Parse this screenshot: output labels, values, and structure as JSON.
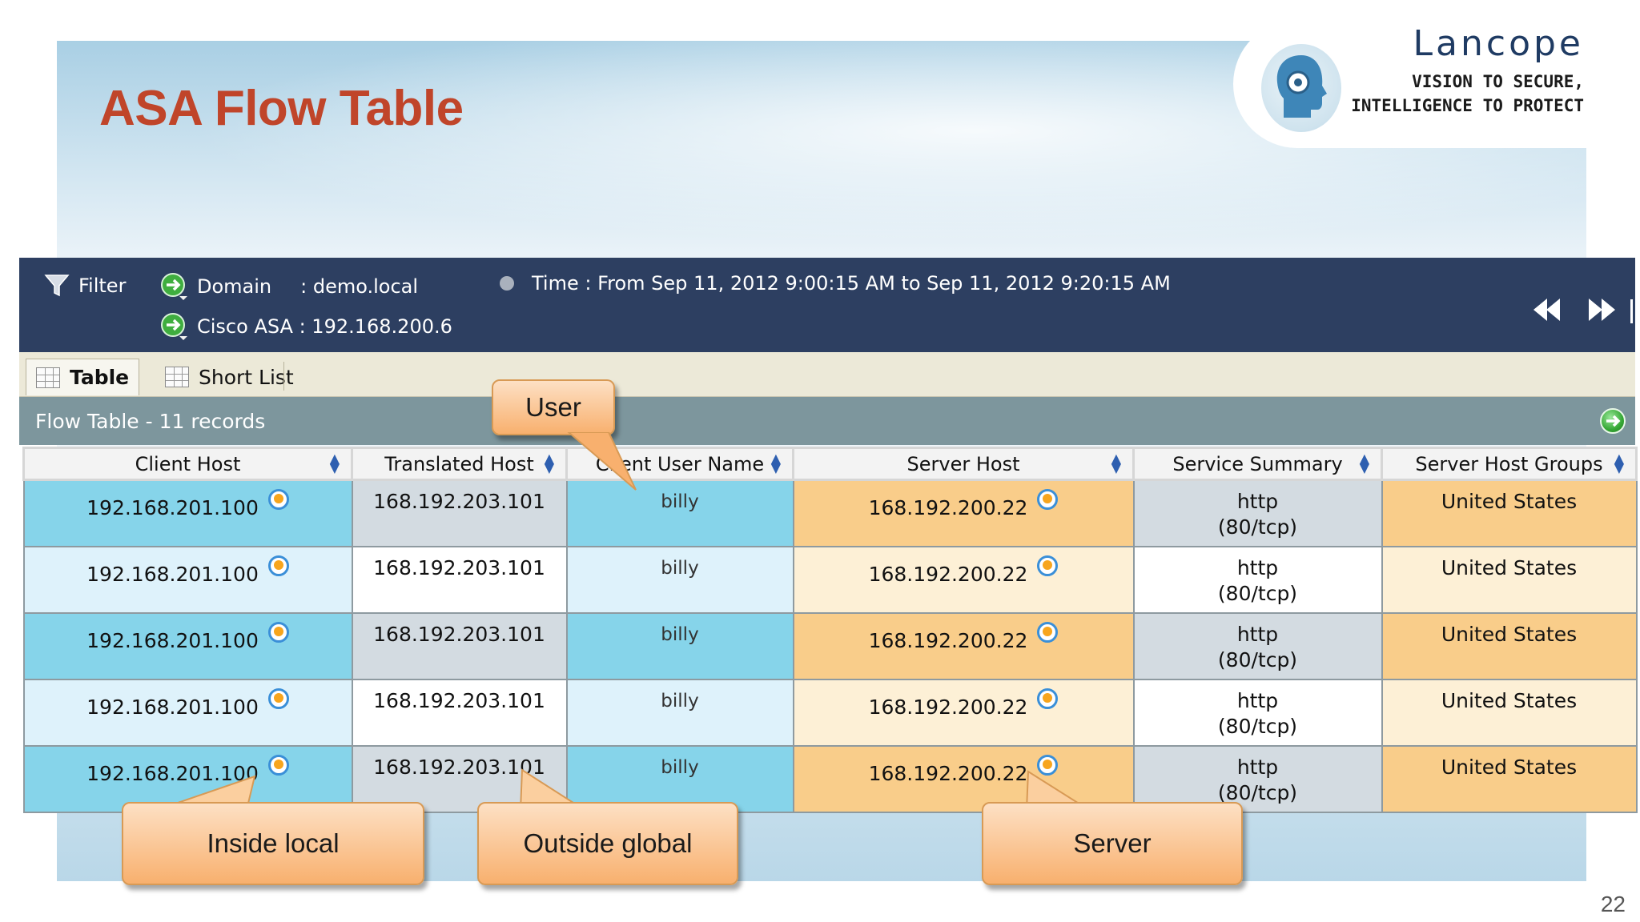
{
  "slide": {
    "title": "ASA Flow Table",
    "page_number": "22",
    "logo": {
      "brand": "Lancope",
      "tagline_line1": "VISION TO SECURE,",
      "tagline_line2": "INTELLIGENCE TO PROTECT"
    }
  },
  "header": {
    "filter_label": "Filter",
    "domain_label": "Domain",
    "domain_value": ": demo.local",
    "time_text": "Time : From Sep 11, 2012 9:00:15 AM to Sep 11, 2012 9:20:15 AM",
    "device_text": "Cisco ASA : 192.168.200.6",
    "nav_prev": "⏪",
    "nav_next": "⏩"
  },
  "tabs": [
    {
      "label": "Table",
      "active": true
    },
    {
      "label": "Short List",
      "active": false
    }
  ],
  "grid": {
    "title": "Flow Table - 11 records",
    "columns": [
      "Client Host",
      "Translated Host",
      "Client User Name",
      "Server Host",
      "Service Summary",
      "Server Host Groups"
    ],
    "rows": [
      {
        "client_host": "192.168.201.100",
        "translated_host": "168.192.203.101",
        "user": "billy",
        "server_host": "168.192.200.22",
        "service_line1": "http",
        "service_line2": "(80/tcp)",
        "groups": "United States"
      },
      {
        "client_host": "192.168.201.100",
        "translated_host": "168.192.203.101",
        "user": "billy",
        "server_host": "168.192.200.22",
        "service_line1": "http",
        "service_line2": "(80/tcp)",
        "groups": "United States"
      },
      {
        "client_host": "192.168.201.100",
        "translated_host": "168.192.203.101",
        "user": "billy",
        "server_host": "168.192.200.22",
        "service_line1": "http",
        "service_line2": "(80/tcp)",
        "groups": "United States"
      },
      {
        "client_host": "192.168.201.100",
        "translated_host": "168.192.203.101",
        "user": "billy",
        "server_host": "168.192.200.22",
        "service_line1": "http",
        "service_line2": "(80/tcp)",
        "groups": "United States"
      },
      {
        "client_host": "192.168.201.100",
        "translated_host": "168.192.203.101",
        "user": "billy",
        "server_host": "168.192.200.22",
        "service_line1": "http",
        "service_line2": "(80/tcp)",
        "groups": "United States"
      }
    ]
  },
  "callouts": {
    "user": "User",
    "inside_local": "Inside local",
    "outside_global": "Outside global",
    "server": "Server"
  },
  "colors": {
    "title": "#c0452a",
    "header_bar": "#2d3f61",
    "grid_title_bar": "#7d969d",
    "client_cells": "#86d4ea",
    "server_cells": "#f9cd8a",
    "callout": "#f8b06e"
  }
}
